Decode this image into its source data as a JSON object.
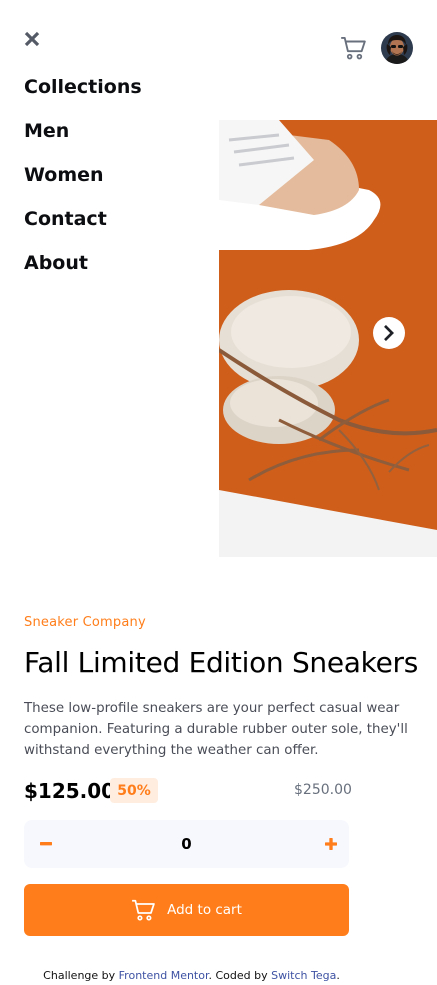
{
  "header": {
    "close_icon": "close-icon",
    "cart_icon": "cart-icon",
    "avatar_alt": "User avatar"
  },
  "menu": {
    "items": [
      "Collections",
      "Men",
      "Women",
      "Contact",
      "About"
    ]
  },
  "gallery": {
    "next_icon": "chevron-right-icon"
  },
  "product": {
    "company": "Sneaker Company",
    "title": "Fall Limited Edition Sneakers",
    "description": "These low-profile sneakers are your perfect casual wear companion. Featuring a durable rubber outer sole, they'll withstand everything the weather can offer.",
    "price": "$125.00",
    "discount": "50%",
    "original_price": "$250.00"
  },
  "quantity": {
    "value": "0",
    "minus_icon": "minus-icon",
    "plus_icon": "plus-icon"
  },
  "cart_button": {
    "label": "Add to cart"
  },
  "footer": {
    "prefix": "Challenge by ",
    "mentor_link": "Frontend Mentor",
    "middle": ". Coded by ",
    "author_link": "Switch Tega",
    "suffix": "."
  },
  "colors": {
    "accent": "#ff7e1b",
    "accent_light": "#ffede0",
    "dark": "#1d2026",
    "muted": "#68707d",
    "surface": "#f7f8fd",
    "link": "#3e52a3"
  }
}
